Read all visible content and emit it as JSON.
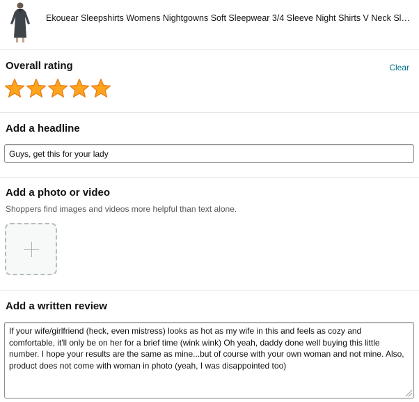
{
  "product": {
    "title": "Ekouear Sleepshirts Womens Nightgowns Soft Sleepwear 3/4 Sleeve Night Shirts V Neck Sleep D…",
    "thumbnail_icon": "product-thumbnail"
  },
  "rating": {
    "heading": "Overall rating",
    "clear_label": "Clear",
    "stars_filled": 5,
    "stars_total": 5,
    "star_color": "#FFA41C"
  },
  "headline": {
    "heading": "Add a headline",
    "value": "Guys, get this for your lady"
  },
  "media": {
    "heading": "Add a photo or video",
    "helper": "Shoppers find images and videos more helpful than text alone.",
    "upload_icon": "plus-icon"
  },
  "review": {
    "heading": "Add a written review",
    "value": "If your wife/girlfriend (heck, even mistress) looks as hot as my wife in this and feels as cozy and comfortable, it'll only be on her for a brief time (wink wink) Oh yeah, daddy done well buying this little number. I hope your results are the same as mine...but of course with your own woman and not mine. Also, product does not come with woman in photo (yeah, I was disappointed too)"
  }
}
